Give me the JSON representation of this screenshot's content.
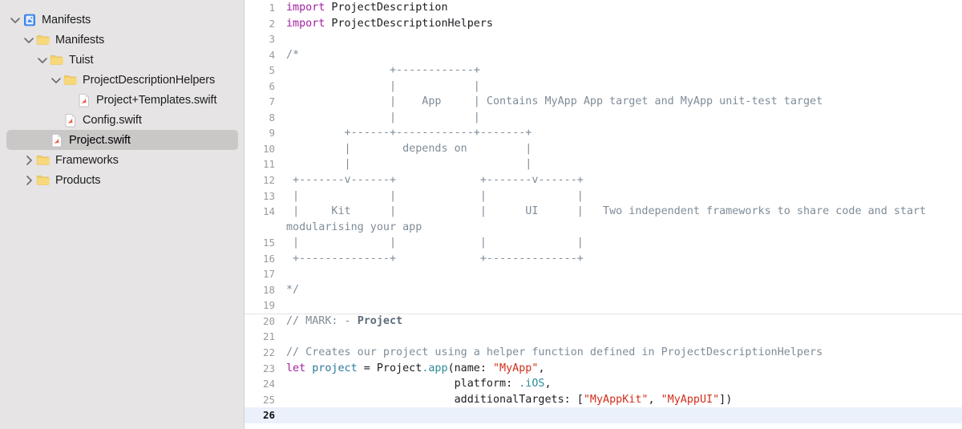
{
  "window": {
    "title": "Project.swift"
  },
  "sidebar": {
    "background": "#e6e4e4",
    "selected_background": "#cac7c7",
    "items": [
      {
        "label": "Manifests",
        "icon": "xcode-project-icon",
        "indent": 0,
        "twisty": "down",
        "selected": false
      },
      {
        "label": "Manifests",
        "icon": "folder-icon",
        "indent": 1,
        "twisty": "down",
        "selected": false
      },
      {
        "label": "Tuist",
        "icon": "folder-icon",
        "indent": 2,
        "twisty": "down",
        "selected": false
      },
      {
        "label": "ProjectDescriptionHelpers",
        "icon": "folder-icon",
        "indent": 3,
        "twisty": "down",
        "selected": false
      },
      {
        "label": "Project+Templates.swift",
        "icon": "swift-file-icon",
        "indent": 4,
        "twisty": "none",
        "selected": false
      },
      {
        "label": "Config.swift",
        "icon": "swift-file-icon",
        "indent": 3,
        "twisty": "none",
        "selected": false
      },
      {
        "label": "Project.swift",
        "icon": "swift-file-icon",
        "indent": 2,
        "twisty": "none",
        "selected": true
      },
      {
        "label": "Frameworks",
        "icon": "folder-icon",
        "indent": 1,
        "twisty": "right",
        "selected": false
      },
      {
        "label": "Products",
        "icon": "folder-icon",
        "indent": 1,
        "twisty": "right",
        "selected": false
      }
    ]
  },
  "editor": {
    "current_line": 26,
    "current_line_highlight": "#eaf1fb",
    "colors": {
      "keyword": "#a21fa2",
      "comment": "#7f8c98",
      "string": "#d12f1b",
      "identifier": "#2b7a9b",
      "member": "#2e8a99",
      "plain": "#1c1c22"
    },
    "lines": [
      {
        "n": 1,
        "kind": "code",
        "text": "import ProjectDescription"
      },
      {
        "n": 2,
        "kind": "code",
        "text": "import ProjectDescriptionHelpers"
      },
      {
        "n": 3,
        "kind": "blank",
        "text": ""
      },
      {
        "n": 4,
        "kind": "comment",
        "text": "/*"
      },
      {
        "n": 5,
        "kind": "comment",
        "text": "                +------------+"
      },
      {
        "n": 6,
        "kind": "comment",
        "text": "                |            |"
      },
      {
        "n": 7,
        "kind": "comment",
        "text": "                |    App     | Contains MyApp App target and MyApp unit-test target"
      },
      {
        "n": 8,
        "kind": "comment",
        "text": "                |            |"
      },
      {
        "n": 9,
        "kind": "comment",
        "text": "         +------+------------+-------+"
      },
      {
        "n": 10,
        "kind": "comment",
        "text": "         |        depends on         |"
      },
      {
        "n": 11,
        "kind": "comment",
        "text": "         |                           |"
      },
      {
        "n": 12,
        "kind": "comment",
        "text": " +-------v------+             +-------v------+"
      },
      {
        "n": 13,
        "kind": "comment",
        "text": " |              |             |              |"
      },
      {
        "n": 14,
        "kind": "comment",
        "text": " |     Kit      |             |      UI      |   Two independent frameworks to share code and start modularising your app"
      },
      {
        "n": 15,
        "kind": "comment",
        "text": " |              |             |              |"
      },
      {
        "n": 16,
        "kind": "comment",
        "text": " +--------------+             +--------------+"
      },
      {
        "n": 17,
        "kind": "blank",
        "text": ""
      },
      {
        "n": 18,
        "kind": "comment",
        "text": "*/"
      },
      {
        "n": 19,
        "kind": "blank",
        "text": ""
      },
      {
        "n": 20,
        "kind": "mark",
        "text": "// MARK: - Project",
        "mark_prefix": "// MARK: - ",
        "mark_title": "Project"
      },
      {
        "n": 21,
        "kind": "blank",
        "text": ""
      },
      {
        "n": 22,
        "kind": "comment",
        "text": "// Creates our project using a helper function defined in ProjectDescriptionHelpers"
      },
      {
        "n": 23,
        "kind": "code",
        "text": "let project = Project.app(name: \"MyApp\","
      },
      {
        "n": 24,
        "kind": "code",
        "text": "                          platform: .iOS,"
      },
      {
        "n": 25,
        "kind": "code",
        "text": "                          additionalTargets: [\"MyAppKit\", \"MyAppUI\"])"
      },
      {
        "n": 26,
        "kind": "blank",
        "text": ""
      }
    ]
  }
}
